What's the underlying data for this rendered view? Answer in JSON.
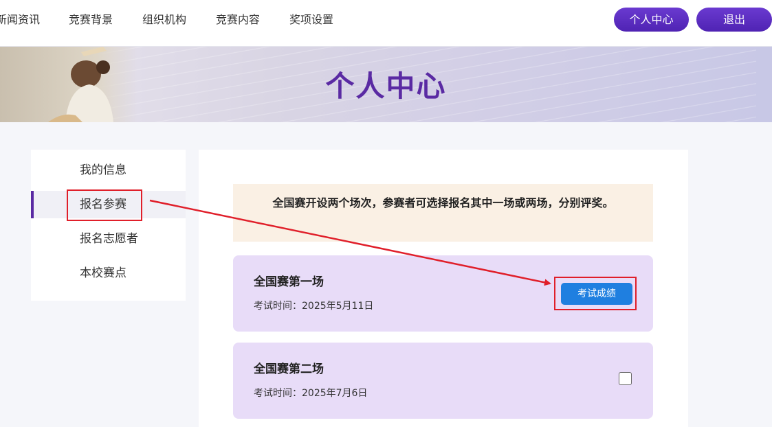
{
  "nav": {
    "links": [
      "新闻资讯",
      "竞赛背景",
      "组织机构",
      "竞赛内容",
      "奖项设置"
    ],
    "profile_button": "个人中心",
    "logout_button": "退出"
  },
  "banner": {
    "title": "个人中心"
  },
  "sidebar": {
    "items": [
      {
        "label": "我的信息"
      },
      {
        "label": "报名参赛"
      },
      {
        "label": "报名志愿者"
      },
      {
        "label": "本校赛点"
      }
    ],
    "active_index": 1
  },
  "main": {
    "notice": "全国赛开设两个场次，参赛者可选择报名其中一场或两场，分别评奖。",
    "sessions": [
      {
        "title": "全国赛第一场",
        "time": "考试时间：2025年5月11日",
        "action_label": "考试成绩"
      },
      {
        "title": "全国赛第二场",
        "time": "考试时间：2025年7月6日",
        "checked": false
      }
    ]
  },
  "colors": {
    "brand_purple": "#5a2aa3",
    "button_blue": "#1f7fe0",
    "card_bg": "#e8dcf8",
    "notice_bg": "#faf0e4",
    "annotation_red": "#e01f2a"
  }
}
